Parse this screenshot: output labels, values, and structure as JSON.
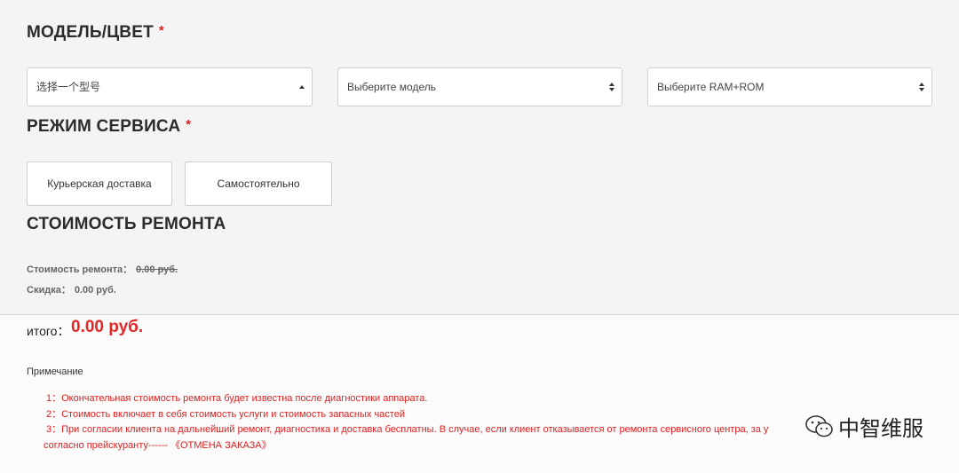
{
  "model": {
    "title": "МОДЕЛЬ/ЦВЕТ",
    "required_mark": "*",
    "select_type": "选择一个型号",
    "select_model": "Выберите модель",
    "select_memory": "Выберите RAM+ROM"
  },
  "service": {
    "title": "РЕЖИМ СЕРВИСА",
    "required_mark": "*",
    "options": [
      "Курьерская доставка",
      "Самостоятельно"
    ]
  },
  "cost": {
    "title": "СТОИМОСТЬ РЕМОНТА",
    "repair_label": "Стоимость ремонта：",
    "repair_value": "0.00 руб.",
    "discount_label": "Скидка：",
    "discount_value": "0.00 руб."
  },
  "total": {
    "label": "итого：",
    "value": "0.00 руб."
  },
  "notes": {
    "title": "Примечание",
    "items": [
      "1：Окончательная стоимость ремонта будет известна после диагностики аппарата.",
      "2：Стоимость включает в себя стоимость услуги и стоимость запасных частей",
      "3：При согласии клиента на дальнейший ремонт, диагностика и доставка бесплатны. В случае, если клиент отказывается от ремонта сервисного центра, за у",
      "согласно прейскуранту------ 《ОТМЕНА ЗАКАЗА》"
    ]
  },
  "watermark": {
    "text": "中智维服",
    "icon": "wechat-icon"
  }
}
